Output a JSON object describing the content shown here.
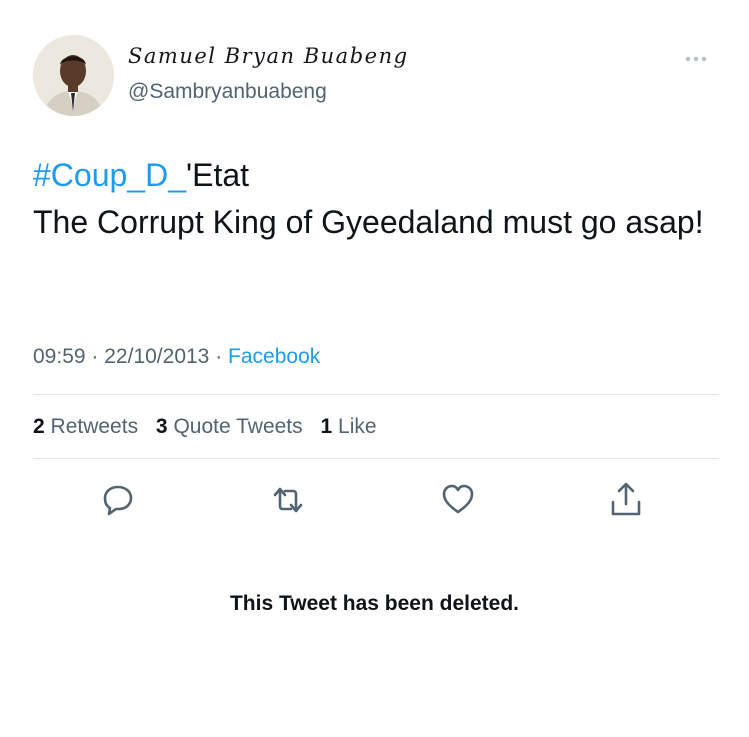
{
  "tweet": {
    "author": {
      "display_name": "Samuel Bryan Buabeng",
      "handle": "@Sambryanbuabeng",
      "avatar_icon": "profile-photo"
    },
    "menu_icon": "more-options-icon",
    "hashtag": "#Coup_D_",
    "hashtag_suffix": "'Etat",
    "body": "The Corrupt King of Gyeedaland must go asap!",
    "time": "09:59",
    "date": "22/10/2013",
    "separator": "·",
    "source": "Facebook",
    "stats": {
      "retweets_count": "2",
      "retweets_label": "Retweets",
      "quotes_count": "3",
      "quotes_label": "Quote Tweets",
      "likes_count": "1",
      "likes_label": "Like"
    },
    "actions": [
      "reply-icon",
      "retweet-icon",
      "like-icon",
      "share-icon"
    ],
    "colors": {
      "accent": "#1d9bf0",
      "secondary_text": "#536471",
      "primary_text": "#0f1419"
    }
  },
  "notice": {
    "deleted_text": "This Tweet has been deleted."
  }
}
